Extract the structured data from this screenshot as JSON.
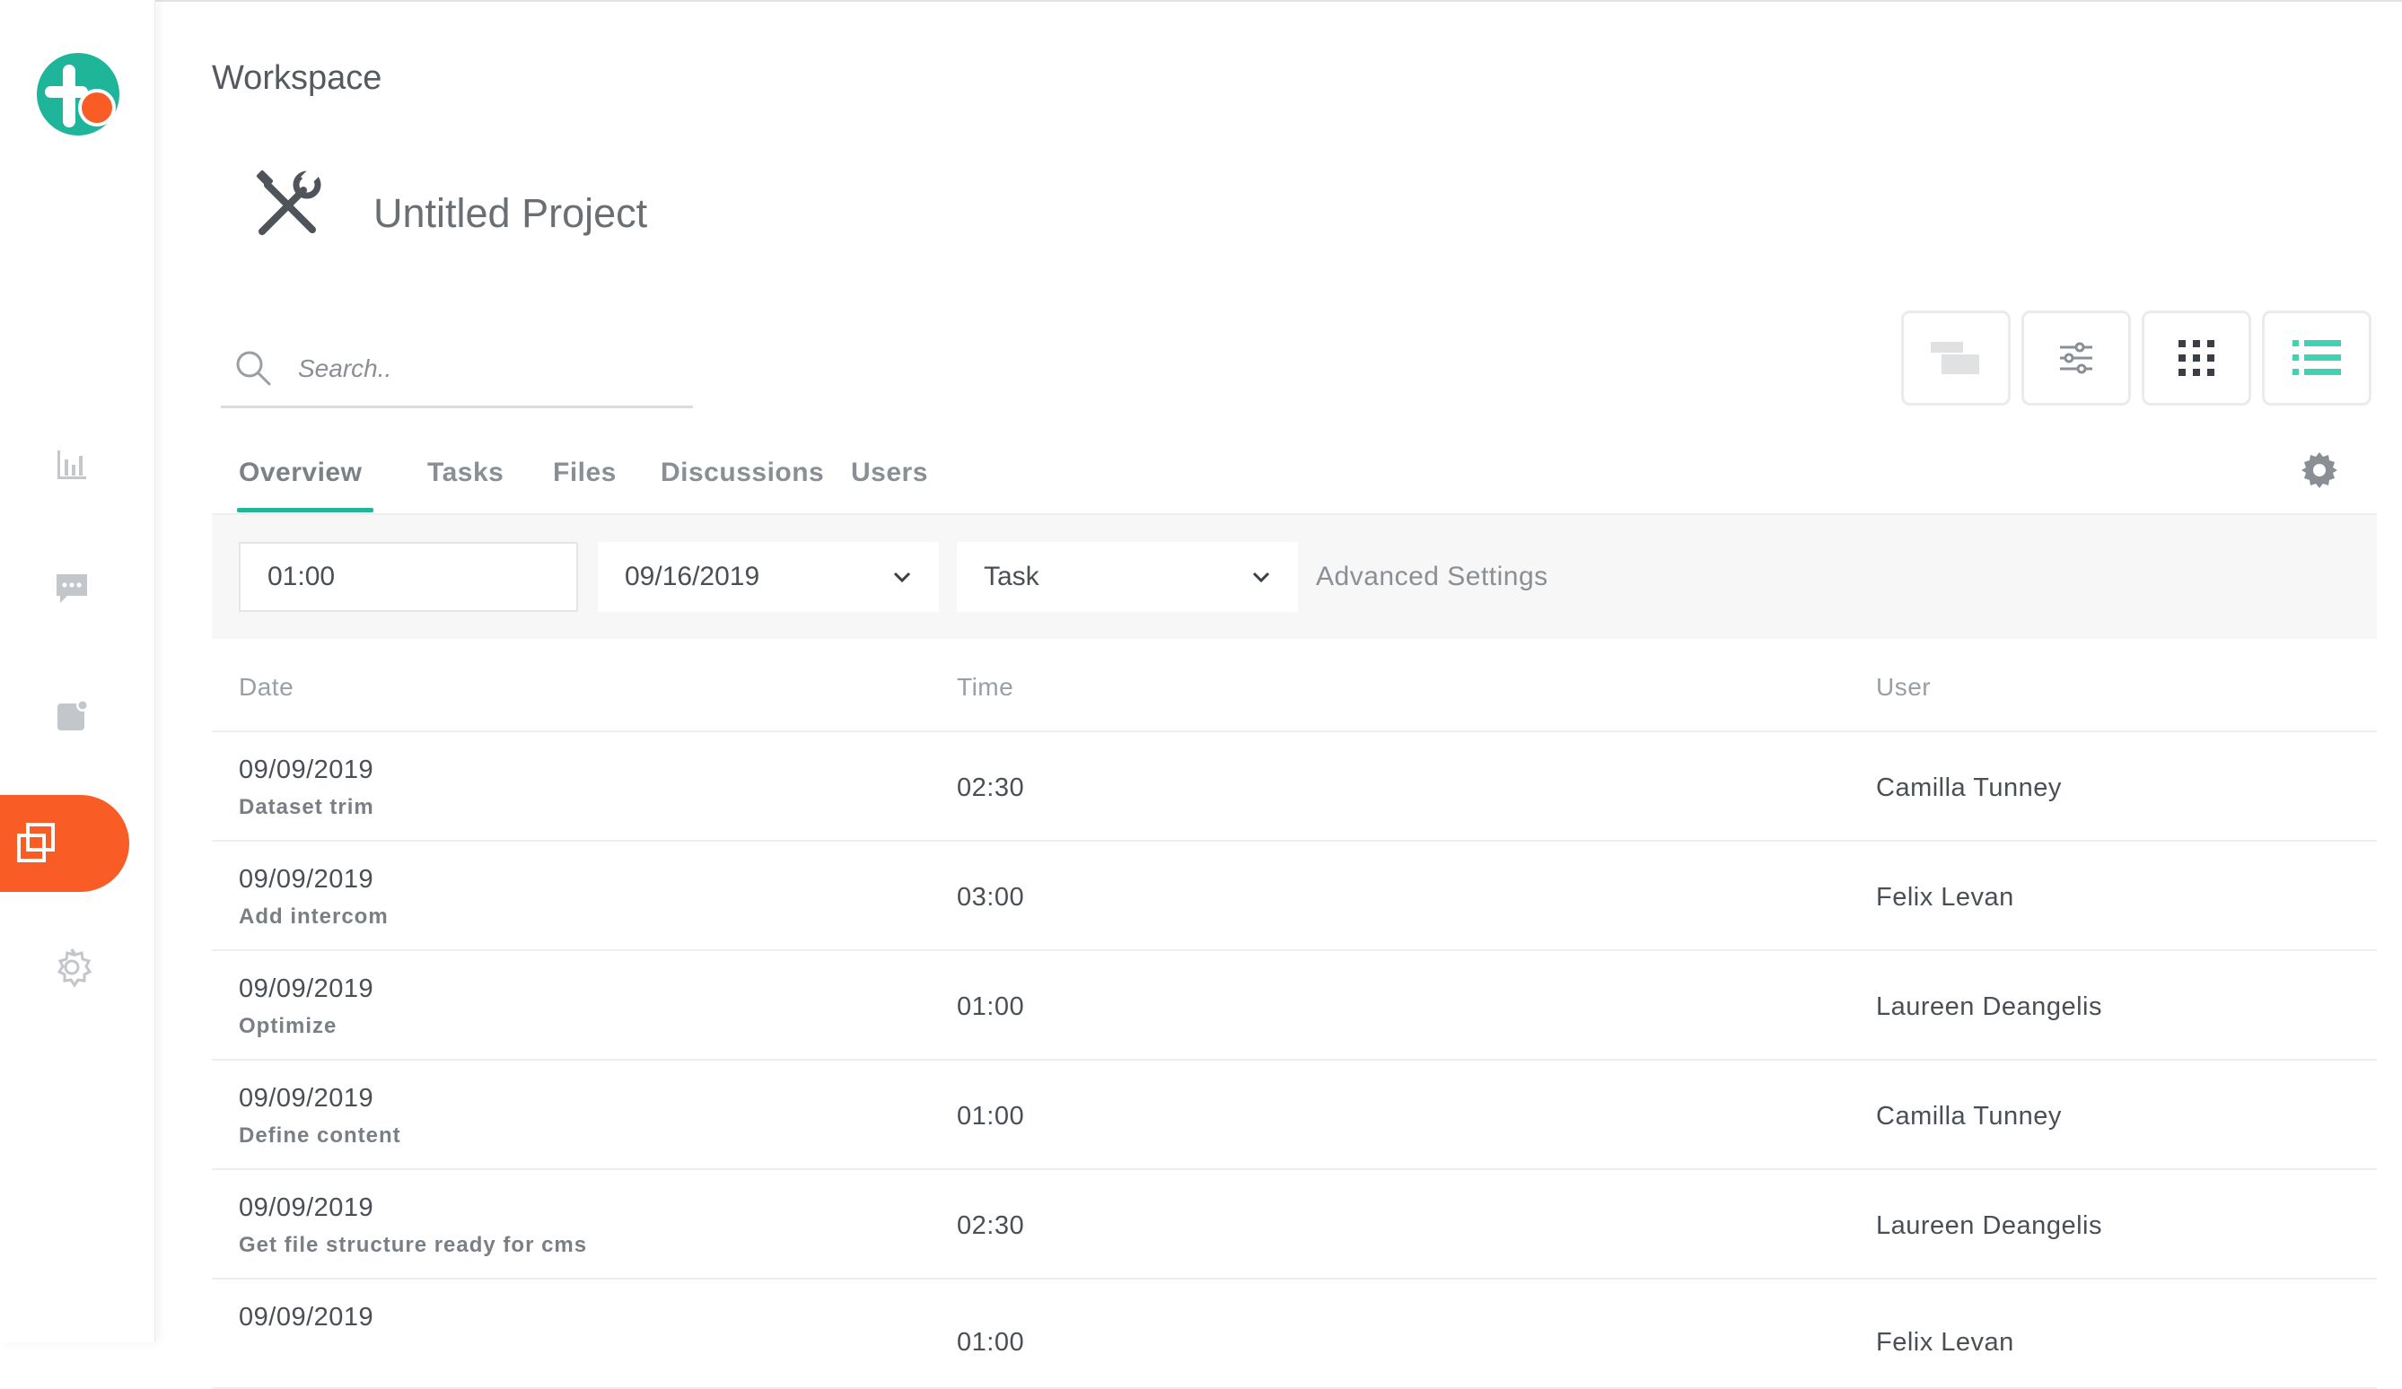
{
  "colors": {
    "accent_orange": "#fa5c25",
    "accent_teal": "#22b59a",
    "logo_teal": "#1fb59a"
  },
  "sidebar": {
    "items": [
      {
        "name": "analytics",
        "icon": "bar-chart-icon"
      },
      {
        "name": "messages",
        "icon": "chat-bubble-icon"
      },
      {
        "name": "notes",
        "icon": "note-icon"
      },
      {
        "name": "projects",
        "icon": "stacked-squares-icon",
        "active": true
      },
      {
        "name": "settings",
        "icon": "gear-icon"
      }
    ]
  },
  "header": {
    "workspace_title": "Workspace",
    "project_title": "Untitled Project",
    "project_icon": "tools-icon"
  },
  "search": {
    "placeholder": "Search.."
  },
  "view_buttons": [
    {
      "name": "gantt-view",
      "icon": "gantt-icon"
    },
    {
      "name": "filter-view",
      "icon": "sliders-icon"
    },
    {
      "name": "grid-view",
      "icon": "grid-icon"
    },
    {
      "name": "list-view",
      "icon": "list-icon",
      "active": true
    }
  ],
  "tabs": [
    {
      "label": "Overview",
      "active": true
    },
    {
      "label": "Tasks"
    },
    {
      "label": "Files"
    },
    {
      "label": "Discussions"
    },
    {
      "label": "Users"
    }
  ],
  "filters": {
    "time_value": "01:00",
    "date_value": "09/16/2019",
    "type_value": "Task",
    "advanced_label": "Advanced Settings"
  },
  "table": {
    "headers": {
      "date": "Date",
      "time": "Time",
      "user": "User"
    },
    "rows": [
      {
        "date": "09/09/2019",
        "task": "Dataset trim",
        "time": "02:30",
        "user": "Camilla Tunney"
      },
      {
        "date": "09/09/2019",
        "task": "Add intercom",
        "time": "03:00",
        "user": "Felix Levan"
      },
      {
        "date": "09/09/2019",
        "task": "Optimize",
        "time": "01:00",
        "user": "Laureen Deangelis"
      },
      {
        "date": "09/09/2019",
        "task": "Define content",
        "time": "01:00",
        "user": "Camilla Tunney"
      },
      {
        "date": "09/09/2019",
        "task": "Get file structure ready for cms",
        "time": "02:30",
        "user": "Laureen Deangelis"
      },
      {
        "date": "09/09/2019",
        "task": "",
        "time": "01:00",
        "user": "Felix Levan"
      }
    ]
  }
}
